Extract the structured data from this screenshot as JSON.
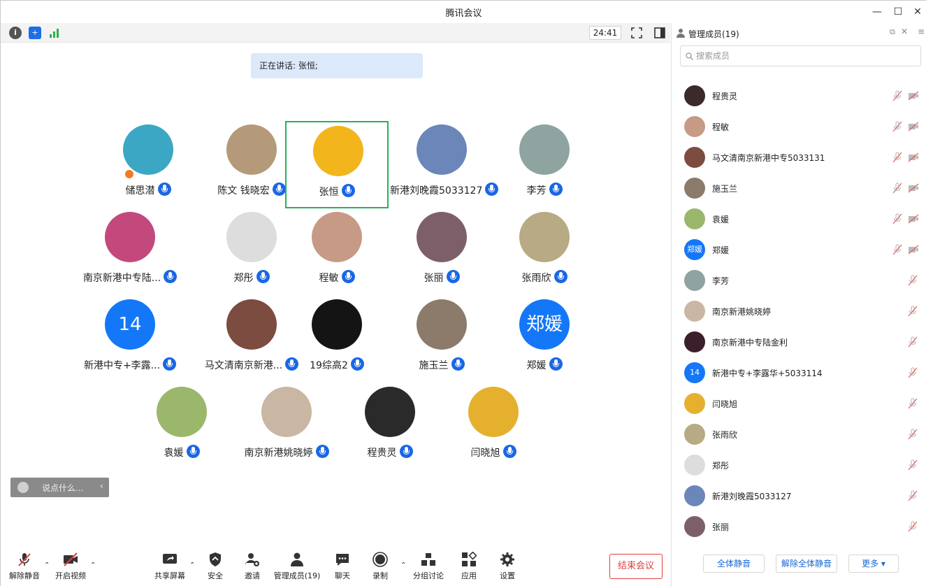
{
  "window": {
    "title": "腾讯会议"
  },
  "topbar": {
    "timer": "24:41"
  },
  "speaking": {
    "label": "正在讲话: 张恒;"
  },
  "gallery": {
    "tiles": [
      {
        "name": "储思潜",
        "color": "#3ba7c4"
      },
      {
        "name": "陈文 钱晓宏",
        "color": "#b49a7a"
      },
      {
        "name": "张恒",
        "color": "#f2b51c"
      },
      {
        "name": "新港刘晚霞5033127",
        "color": "#6b86b8"
      },
      {
        "name": "李芳",
        "color": "#8fa3a0"
      },
      {
        "name": "南京新港中专陆...",
        "color": "#c3497d"
      },
      {
        "name": "郑彤",
        "color": "#dddddd"
      },
      {
        "name": "程敏",
        "color": "#c79a85"
      },
      {
        "name": "张丽",
        "color": "#7d5f6a"
      },
      {
        "name": "张雨欣",
        "color": "#b7aa84"
      },
      {
        "name": "新港中专+李露...",
        "letter": "14"
      },
      {
        "name": "马文清南京新港...",
        "color": "#7b4c3f"
      },
      {
        "name": "19综高2",
        "color": "#141414"
      },
      {
        "name": "施玉兰",
        "color": "#8c7b6a"
      },
      {
        "name": "郑媛",
        "letter": "郑媛"
      },
      {
        "name": "袁媛",
        "color": "#9ab76b"
      },
      {
        "name": "南京新港姚晓婷",
        "color": "#c9b7a3"
      },
      {
        "name": "程贵灵",
        "color": "#2a2a2a"
      },
      {
        "name": "闫晓旭",
        "color": "#e6b02f"
      }
    ]
  },
  "chat": {
    "placeholder": "说点什么..."
  },
  "toolbar": {
    "unmute": "解除静音",
    "video": "开启视频",
    "share": "共享屏幕",
    "security": "安全",
    "invite": "邀请",
    "members": "管理成员(19)",
    "chat": "聊天",
    "record": "录制",
    "breakout": "分组讨论",
    "apps": "应用",
    "settings": "设置",
    "end": "结束会议"
  },
  "panel": {
    "title": "管理成员(19)",
    "search_placeholder": "搜索成员",
    "members": [
      {
        "name": "程贵灵",
        "color": "#3a2a2a",
        "cam": true
      },
      {
        "name": "程敏",
        "color": "#c79a85",
        "cam": true
      },
      {
        "name": "马文清南京新港中专5033131",
        "color": "#7b4c3f",
        "cam": true
      },
      {
        "name": "施玉兰",
        "color": "#8c7b6a",
        "cam": true
      },
      {
        "name": "袁媛",
        "color": "#9ab76b",
        "cam": true
      },
      {
        "name": "郑媛",
        "letter": "郑媛",
        "cam": true
      },
      {
        "name": "李芳",
        "color": "#8fa3a0",
        "cam": false
      },
      {
        "name": "南京新港姚晓婷",
        "color": "#c9b7a3",
        "cam": false
      },
      {
        "name": "南京新港中专陆金利",
        "color": "#3b1f2a",
        "cam": false
      },
      {
        "name": "新港中专+李露华+5033114",
        "letter": "14",
        "cam": false
      },
      {
        "name": "闫晓旭",
        "color": "#e6b02f",
        "cam": false
      },
      {
        "name": "张雨欣",
        "color": "#b7aa84",
        "cam": false
      },
      {
        "name": "郑彤",
        "color": "#dddddd",
        "cam": false
      },
      {
        "name": "新港刘晚霞5033127",
        "color": "#6b86b8",
        "cam": false
      },
      {
        "name": "张丽",
        "color": "#7d5f6a",
        "cam": false
      }
    ],
    "mute_all": "全体静音",
    "unmute_all": "解除全体静音",
    "more": "更多"
  }
}
